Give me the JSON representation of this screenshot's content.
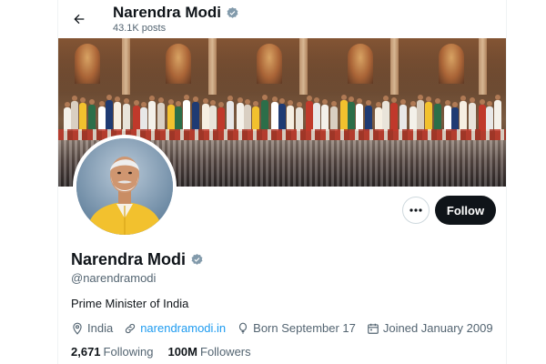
{
  "header": {
    "name": "Narendra Modi",
    "post_count": "43.1K posts",
    "back_icon": "back-arrow-icon",
    "verified_icon": "verified-badge-icon"
  },
  "banner": {
    "description_icon": "cover-photo"
  },
  "avatar": {
    "icon": "profile-photo"
  },
  "actions": {
    "more_icon": "more-options-icon",
    "follow_label": "Follow"
  },
  "profile": {
    "name": "Narendra Modi",
    "handle": "@narendramodi",
    "bio": "Prime Minister of India",
    "location": "India",
    "website": "narendramodi.in",
    "birthday": "Born September 17",
    "joined": "Joined January 2009",
    "following_count": "2,671",
    "following_label": "Following",
    "followers_count": "100M",
    "followers_label": "Followers"
  },
  "colors": {
    "accent": "#1d9bf0",
    "text": "#0f1419",
    "muted": "#536471",
    "follow_button": "#0f1419",
    "vest": "#f2c12e"
  }
}
